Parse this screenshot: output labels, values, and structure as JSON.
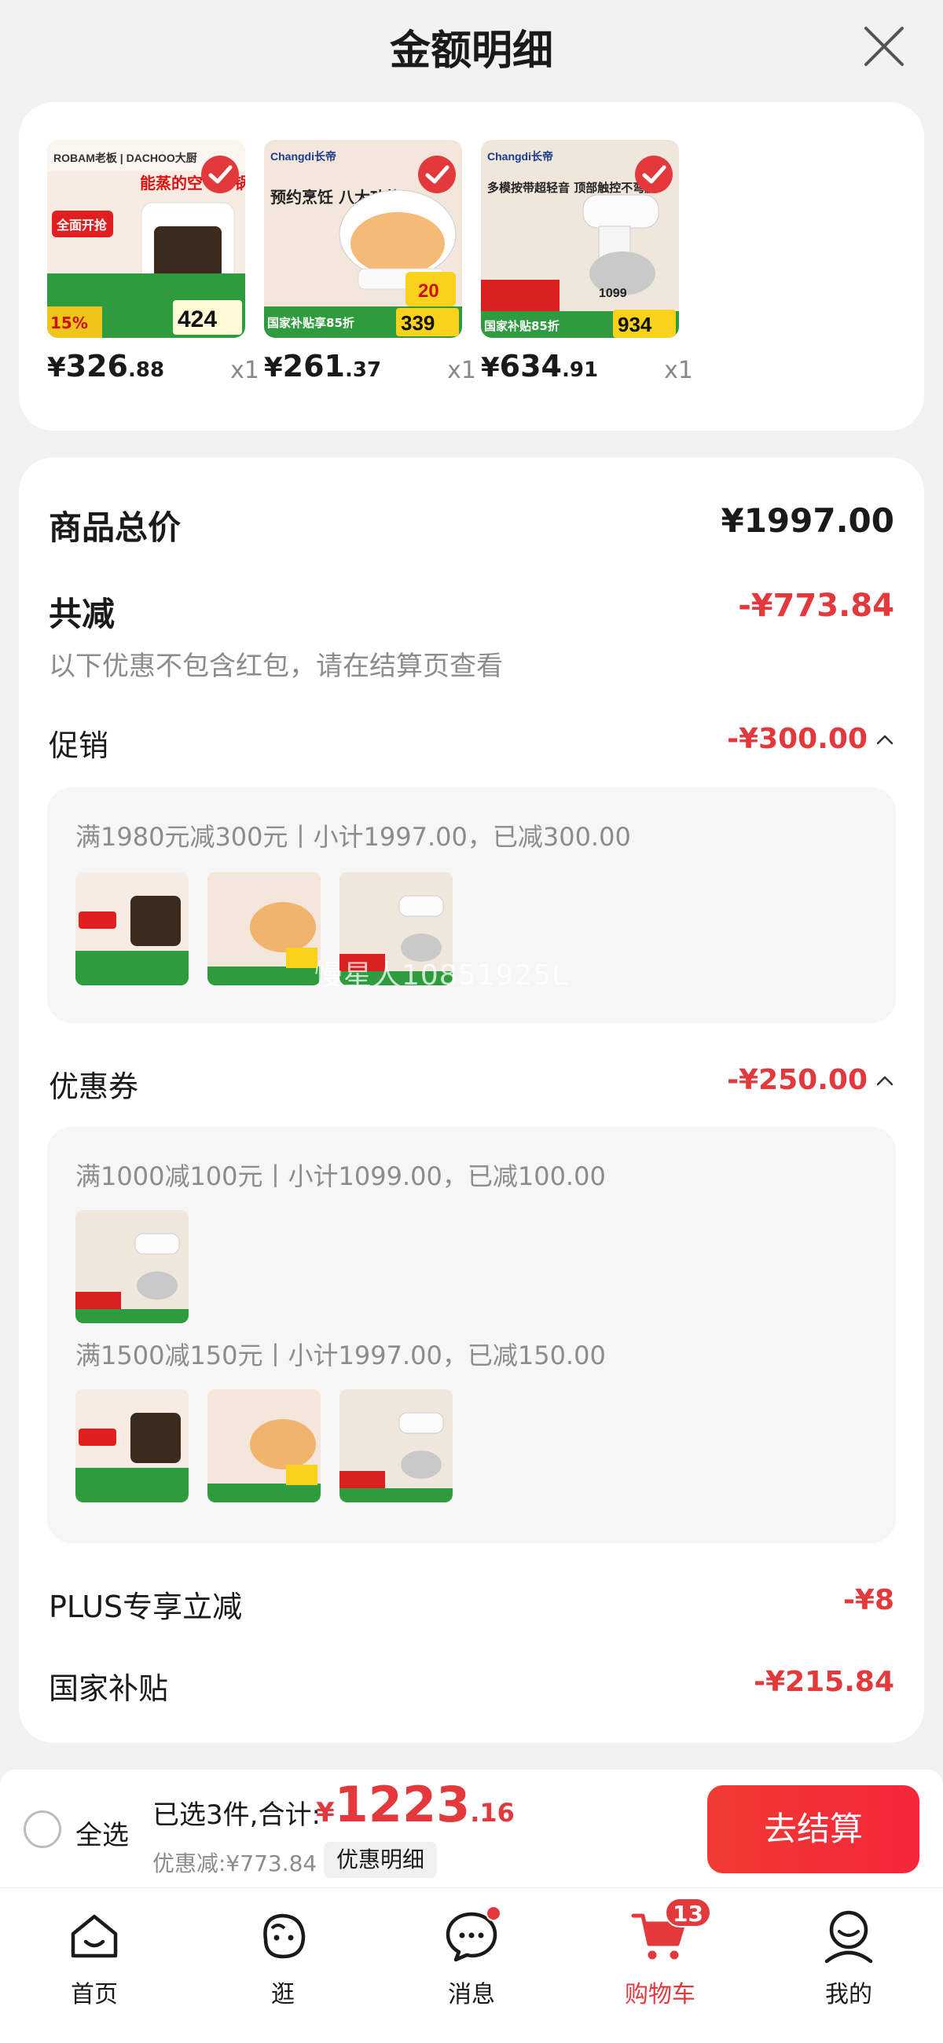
{
  "header": {
    "title": "金额明细",
    "close_icon": "close-icon"
  },
  "products": [
    {
      "price_currency": "¥",
      "price_int": "326",
      "price_dec": ".88",
      "qty": "x1",
      "brand": "ROBAM老板 | DACHOO大厨",
      "headline": "能蒸的空气炸锅",
      "badge_text": "全面开抢",
      "promo_pct": "15%",
      "promo_price": "424"
    },
    {
      "price_currency": "¥",
      "price_int": "261",
      "price_dec": ".37",
      "qty": "x1",
      "brand": "Changdi长帝",
      "headline": "预约烹饪 八大功能",
      "badge_text": "国家补贴享85折",
      "promo_pct": "20",
      "promo_price": "339"
    },
    {
      "price_currency": "¥",
      "price_int": "634",
      "price_dec": ".91",
      "qty": "x1",
      "brand": "Changdi长帝",
      "headline": "多模按带超轻音 顶部触控不弯腰",
      "badge_text": "国家补贴85折",
      "promo_pct": "1099",
      "promo_price": "934"
    }
  ],
  "summary": {
    "total_label": "商品总价",
    "total_value": "¥1997.00",
    "reduce_label": "共减",
    "reduce_value": "-¥773.84",
    "reduce_note": "以下优惠不包含红包，请在结算页查看",
    "promo_label": "促销",
    "promo_value": "-¥300.00",
    "promo_detail": "满1980元减300元丨小计1997.00，已减300.00",
    "coupon_label": "优惠券",
    "coupon_value": "-¥250.00",
    "coupon_detail_1": "满1000减100元丨小计1099.00，已减100.00",
    "coupon_detail_2": "满1500减150元丨小计1997.00，已减150.00",
    "plus_label": "PLUS专享立减",
    "plus_value": "-¥8",
    "subsidy_label": "国家补贴",
    "subsidy_value": "-¥215.84",
    "watermark": "慢星人10851925L"
  },
  "checkout": {
    "select_all_label": "全选",
    "selected_text": "已选3件,合计:",
    "total_currency": "¥",
    "total_int": "1223",
    "total_dec": ".16",
    "discount_text": "优惠减:¥773.84",
    "detail_chip": "优惠明细",
    "checkout_button": "去结算"
  },
  "nav": {
    "items": [
      {
        "label": "首页",
        "icon": "home-icon"
      },
      {
        "label": "逛",
        "icon": "browse-icon"
      },
      {
        "label": "消息",
        "icon": "message-icon"
      },
      {
        "label": "购物车",
        "icon": "cart-icon",
        "badge": "13"
      },
      {
        "label": "我的",
        "icon": "profile-icon"
      }
    ]
  },
  "colors": {
    "accent": "#e4393c",
    "background": "#f2f2f2",
    "card": "#ffffff"
  }
}
